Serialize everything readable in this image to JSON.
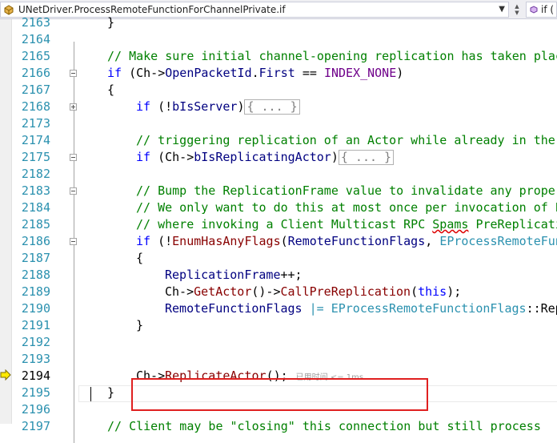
{
  "nav": {
    "scope": "UNetDriver.ProcessRemoteFunctionForChannelPrivate.if",
    "member": "if (",
    "dropdown_icon": "chevron-down-icon"
  },
  "lines": [
    {
      "n": "2163",
      "html": "<span class=\"fold-dummy\"></span>}"
    },
    {
      "n": "2164"
    },
    {
      "n": "2165"
    },
    {
      "n": "2166"
    },
    {
      "n": "2167"
    },
    {
      "n": "2168"
    },
    {
      "n": "2173"
    },
    {
      "n": "2174"
    },
    {
      "n": "2175"
    },
    {
      "n": "2182"
    },
    {
      "n": "2183"
    },
    {
      "n": "2184"
    },
    {
      "n": "2185"
    },
    {
      "n": "2186"
    },
    {
      "n": "2187"
    },
    {
      "n": "2188"
    },
    {
      "n": "2189"
    },
    {
      "n": "2190"
    },
    {
      "n": "2191"
    },
    {
      "n": "2192"
    },
    {
      "n": "2193"
    },
    {
      "n": "2194"
    },
    {
      "n": "2195"
    },
    {
      "n": "2196"
    },
    {
      "n": "2197"
    }
  ],
  "code": {
    "l2163": "}",
    "l2165": "// Make sure initial channel-opening replication has taken place",
    "l2166_kw": "if",
    "l2166_a": " (Ch->",
    "l2166_b": "OpenPacketId",
    "l2166_c": ".",
    "l2166_d": "First",
    "l2166_e": " == ",
    "l2166_f": "INDEX_NONE",
    "l2166_g": ")",
    "l2167": "{",
    "l2168_kw": "if",
    "l2168_a": " (!",
    "l2168_b": "bIsServer",
    "l2168_c": ")",
    "collapsed": "{ ... }",
    "l2174": "// triggering replication of an Actor while already in the",
    "l2175_kw": "if",
    "l2175_a": " (Ch->",
    "l2175_b": "bIsReplicatingActor",
    "l2175_c": ")",
    "l2183": "// Bump the ReplicationFrame value to invalidate any propert",
    "l2184": "// We only want to do this at most once per invocation of P",
    "l2185_a": "// where invoking a Client Multicast RPC ",
    "l2185_b": "Spams",
    "l2185_c": " PreReplicati",
    "l2186_kw": "if",
    "l2186_a": " (!",
    "l2186_b": "EnumHasAnyFlags",
    "l2186_c": "(",
    "l2186_d": "RemoteFunctionFlags",
    "l2186_e": ", ",
    "l2186_f": "EProcessRemoteFun",
    "l2187": "{",
    "l2188_a": "ReplicationFrame",
    "l2188_b": "++;",
    "l2189_a": "Ch->",
    "l2189_b": "GetActor",
    "l2189_c": "()->",
    "l2189_d": "CallPreReplication",
    "l2189_e": "(",
    "l2189_f": "this",
    "l2189_g": ");",
    "l2190_a": "RemoteFunctionFlags",
    "l2190_b": " |= ",
    "l2190_c": "EProcessRemoteFunctionFlags",
    "l2190_d": "::Rep",
    "l2191": "}",
    "l2194_a": "Ch->",
    "l2194_b": "ReplicateActor",
    "l2194_c": "();",
    "perf_tip": "已用时间 <= 1ms",
    "l2195": "}",
    "l2197": "// Client may be \"closing\" this connection but still process"
  },
  "colors": {
    "line_number": "#2b91af",
    "comment": "#008000",
    "keyword": "#0000ff",
    "highlight_box": "#e02020"
  }
}
